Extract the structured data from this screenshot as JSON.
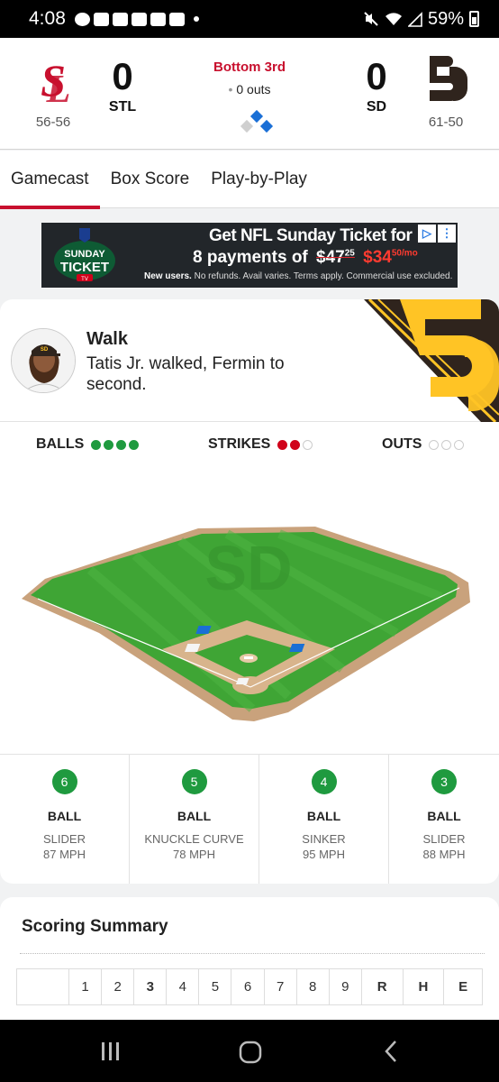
{
  "status_bar": {
    "time": "4:08",
    "battery": "59%"
  },
  "game": {
    "away": {
      "abbr": "STL",
      "score": "0",
      "record": "56-56",
      "color": "#c8102e"
    },
    "home": {
      "abbr": "SD",
      "score": "0",
      "record": "61-50",
      "color": "#2f241d"
    },
    "inning_state": "Bottom 3rd",
    "outs_text": "0 outs",
    "bases": {
      "first": true,
      "second": true,
      "third": false
    }
  },
  "tabs": [
    {
      "label": "Gamecast",
      "active": true
    },
    {
      "label": "Box Score",
      "active": false
    },
    {
      "label": "Play-by-Play",
      "active": false
    }
  ],
  "ad": {
    "badge_line1": "SUNDAY",
    "badge_line2": "TICKET",
    "badge_line3": "TV",
    "headline": "Get NFL Sunday Ticket for",
    "offer_prefix": "8 payments of",
    "old_price": "$47",
    "old_cents": "25",
    "new_price": "$34",
    "new_cents": "50/mo",
    "fine_bold": "New users.",
    "fine_print": "No refunds. Avail varies. Terms apply. Commercial use excluded."
  },
  "play": {
    "title": "Walk",
    "description": "Tatis Jr. walked, Fermin to second."
  },
  "count": {
    "balls_label": "BALLS",
    "balls": 4,
    "balls_max": 4,
    "strikes_label": "STRIKES",
    "strikes": 2,
    "strikes_max": 3,
    "outs_label": "OUTS",
    "outs": 0,
    "outs_max": 3
  },
  "pitches": [
    {
      "num": "6",
      "result": "BALL",
      "type": "SLIDER",
      "speed": "87 MPH"
    },
    {
      "num": "5",
      "result": "BALL",
      "type": "KNUCKLE CURVE",
      "speed": "78 MPH"
    },
    {
      "num": "4",
      "result": "BALL",
      "type": "SINKER",
      "speed": "95 MPH"
    },
    {
      "num": "3",
      "result": "BALL",
      "type": "SLIDER",
      "speed": "88 MPH"
    }
  ],
  "scoring_summary": {
    "title": "Scoring Summary",
    "columns": [
      "1",
      "2",
      "3",
      "4",
      "5",
      "6",
      "7",
      "8",
      "9",
      "R",
      "H",
      "E"
    ]
  },
  "colors": {
    "accent": "#c8102e",
    "field_green": "#3fa535",
    "ball_green": "#1f9a3f",
    "strike_red": "#d0021b",
    "padres_gold": "#ffc425"
  }
}
